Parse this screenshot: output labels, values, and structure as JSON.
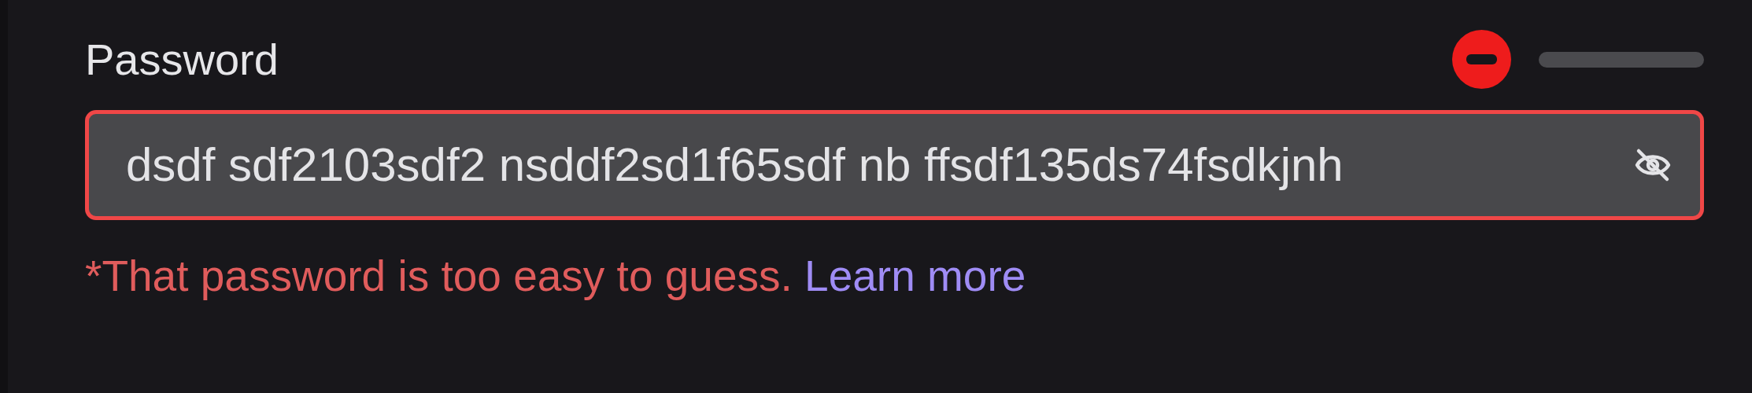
{
  "password_field": {
    "label": "Password",
    "value": "dsdf sdf2103sdf2 nsddf2sd1f65sdf nb ffsdf135ds74fsdkjnh",
    "invalid": true,
    "masked": false
  },
  "strength": {
    "weak": true,
    "level": 0
  },
  "error": {
    "message": "*That password is too easy to guess.",
    "link": "Learn more"
  }
}
